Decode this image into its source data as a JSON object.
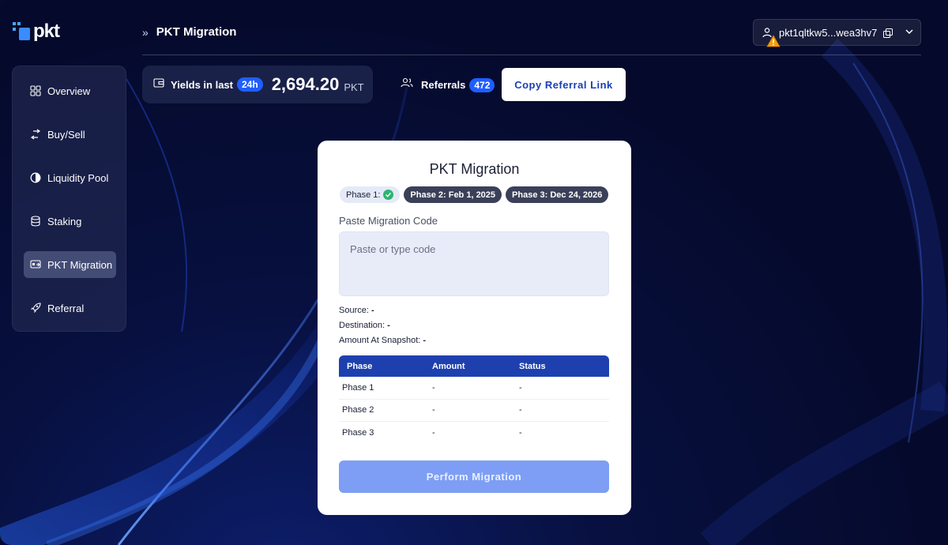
{
  "app": {
    "logo_text": "pkt",
    "accent": "#1f5eff"
  },
  "header": {
    "breadcrumb_chevron": "»",
    "title": "PKT Migration"
  },
  "wallet": {
    "address": "pkt1qltkw5...wea3hv7",
    "warning_icon": "warning-icon"
  },
  "sidebar": {
    "items": [
      {
        "label": "Overview",
        "icon": "grid-icon",
        "active": false
      },
      {
        "label": "Buy/Sell",
        "icon": "swap-arrows-icon",
        "active": false
      },
      {
        "label": "Liquidity Pool",
        "icon": "pie-chart-icon",
        "active": false
      },
      {
        "label": "Staking",
        "icon": "database-icon",
        "active": false
      },
      {
        "label": "PKT Migration",
        "icon": "migrate-icon",
        "active": true
      },
      {
        "label": "Referral",
        "icon": "rocket-icon",
        "active": false
      }
    ]
  },
  "stats": {
    "yields_label": "Yields in last",
    "yields_period": "24h",
    "yields_value": "2,694.20",
    "yields_unit": "PKT",
    "referrals_label": "Referrals",
    "referrals_count": "472",
    "copy_referral_label": "Copy Referral Link"
  },
  "migration": {
    "title": "PKT Migration",
    "phases": [
      {
        "label": "Phase 1:",
        "status": "complete"
      },
      {
        "label": "Phase 2: Feb 1, 2025",
        "status": "upcoming"
      },
      {
        "label": "Phase 3: Dec 24, 2026",
        "status": "upcoming"
      }
    ],
    "code_label": "Paste Migration Code",
    "code_placeholder": "Paste or type code",
    "code_value": "",
    "source_label": "Source:",
    "source_value": "-",
    "destination_label": "Destination:",
    "destination_value": "-",
    "snapshot_label": "Amount At Snapshot:",
    "snapshot_value": "-",
    "table": {
      "headers": [
        "Phase",
        "Amount",
        "Status"
      ],
      "rows": [
        [
          "Phase 1",
          "-",
          "-"
        ],
        [
          "Phase 2",
          "-",
          "-"
        ],
        [
          "Phase 3",
          "-",
          "-"
        ]
      ]
    },
    "perform_label": "Perform Migration"
  }
}
